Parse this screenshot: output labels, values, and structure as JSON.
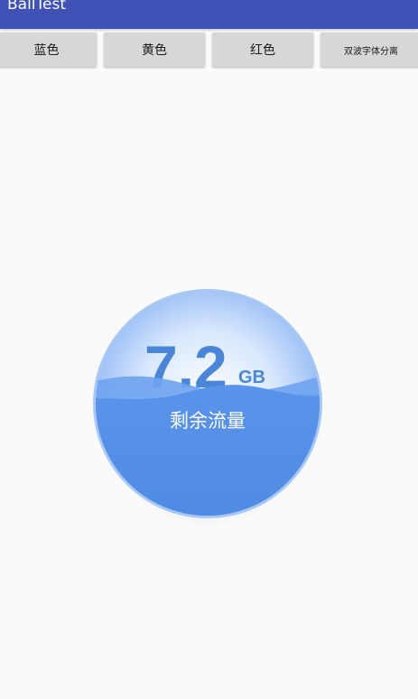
{
  "app_bar": {
    "title": "BallTest",
    "color": "#3f51b5"
  },
  "buttons": {
    "blue": "蓝色",
    "yellow": "黄色",
    "red": "红色",
    "double_wave": "双波字体分离"
  },
  "ball": {
    "value": "7.2",
    "unit": "GB",
    "label": "剩余流量",
    "wave_color": "#5590e6",
    "text_color": "#4a86d8"
  }
}
